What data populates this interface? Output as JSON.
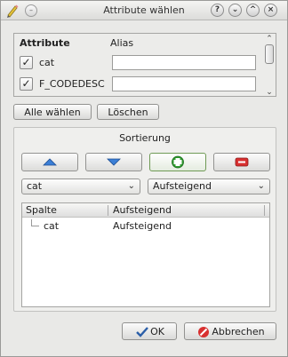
{
  "window": {
    "title": "Attribute wählen",
    "title_buttons": [
      "?",
      "⌄",
      "^",
      "×"
    ]
  },
  "attributes": {
    "header_attribute": "Attribute",
    "header_alias": "Alias",
    "rows": [
      {
        "name": "cat",
        "checked": true,
        "alias": ""
      },
      {
        "name": "F_CODEDESC",
        "checked": true,
        "alias": ""
      }
    ]
  },
  "buttons": {
    "select_all": "Alle wählen",
    "clear": "Löschen",
    "ok": "OK",
    "cancel": "Abbrechen"
  },
  "sort": {
    "title": "Sortierung",
    "attribute_combo": "cat",
    "order_combo": "Aufsteigend",
    "table_headers": [
      "Spalte",
      "Aufsteigend"
    ],
    "rows": [
      {
        "column": "cat",
        "order": "Aufsteigend"
      }
    ]
  },
  "colors": {
    "accent_green": "#2e9a2e",
    "remove_red": "#d83030",
    "arrow_blue": "#3b7fd6"
  }
}
